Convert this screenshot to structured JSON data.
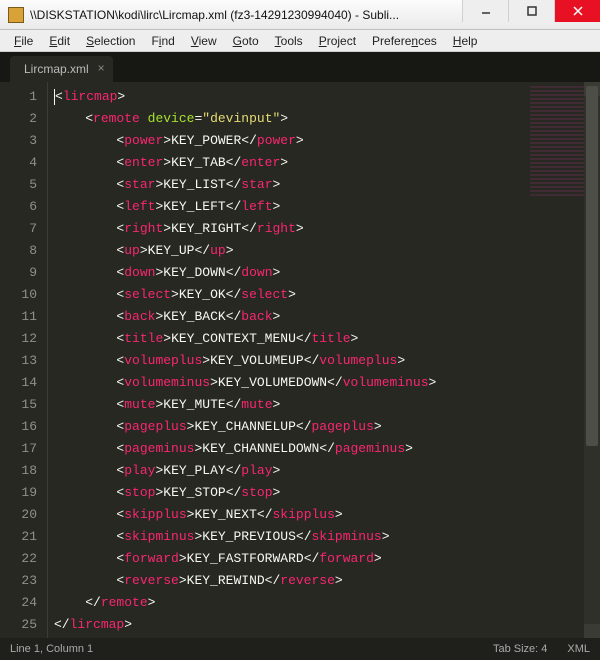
{
  "window": {
    "title": "\\\\DISKSTATION\\kodi\\lirc\\Lircmap.xml (fz3-14291230994040) - Subli..."
  },
  "menu": {
    "items": [
      {
        "label": "File",
        "hot": "F"
      },
      {
        "label": "Edit",
        "hot": "E"
      },
      {
        "label": "Selection",
        "hot": "S"
      },
      {
        "label": "Find",
        "hot": "i"
      },
      {
        "label": "View",
        "hot": "V"
      },
      {
        "label": "Goto",
        "hot": "G"
      },
      {
        "label": "Tools",
        "hot": "T"
      },
      {
        "label": "Project",
        "hot": "P"
      },
      {
        "label": "Preferences",
        "hot": "n"
      },
      {
        "label": "Help",
        "hot": "H"
      }
    ]
  },
  "tab": {
    "label": "Lircmap.xml"
  },
  "statusbar": {
    "position": "Line 1, Column 1",
    "tabsize": "Tab Size: 4",
    "syntax": "XML"
  },
  "code": {
    "indent": "    ",
    "root_open": {
      "tag": "lircmap"
    },
    "remote_open": {
      "tag": "remote",
      "attr": "device",
      "val": "\"devinput\""
    },
    "entries": [
      {
        "tag": "power",
        "text": "KEY_POWER"
      },
      {
        "tag": "enter",
        "text": "KEY_TAB"
      },
      {
        "tag": "star",
        "text": "KEY_LIST"
      },
      {
        "tag": "left",
        "text": "KEY_LEFT"
      },
      {
        "tag": "right",
        "text": "KEY_RIGHT"
      },
      {
        "tag": "up",
        "text": "KEY_UP"
      },
      {
        "tag": "down",
        "text": "KEY_DOWN"
      },
      {
        "tag": "select",
        "text": "KEY_OK"
      },
      {
        "tag": "back",
        "text": "KEY_BACK"
      },
      {
        "tag": "title",
        "text": "KEY_CONTEXT_MENU"
      },
      {
        "tag": "volumeplus",
        "text": "KEY_VOLUMEUP"
      },
      {
        "tag": "volumeminus",
        "text": "KEY_VOLUMEDOWN"
      },
      {
        "tag": "mute",
        "text": "KEY_MUTE"
      },
      {
        "tag": "pageplus",
        "text": "KEY_CHANNELUP"
      },
      {
        "tag": "pageminus",
        "text": "KEY_CHANNELDOWN"
      },
      {
        "tag": "play",
        "text": "KEY_PLAY"
      },
      {
        "tag": "stop",
        "text": "KEY_STOP"
      },
      {
        "tag": "skipplus",
        "text": "KEY_NEXT"
      },
      {
        "tag": "skipminus",
        "text": "KEY_PREVIOUS"
      },
      {
        "tag": "forward",
        "text": "KEY_FASTFORWARD"
      },
      {
        "tag": "reverse",
        "text": "KEY_REWIND"
      }
    ],
    "remote_close": {
      "tag": "remote"
    },
    "root_close": {
      "tag": "lircmap"
    }
  }
}
